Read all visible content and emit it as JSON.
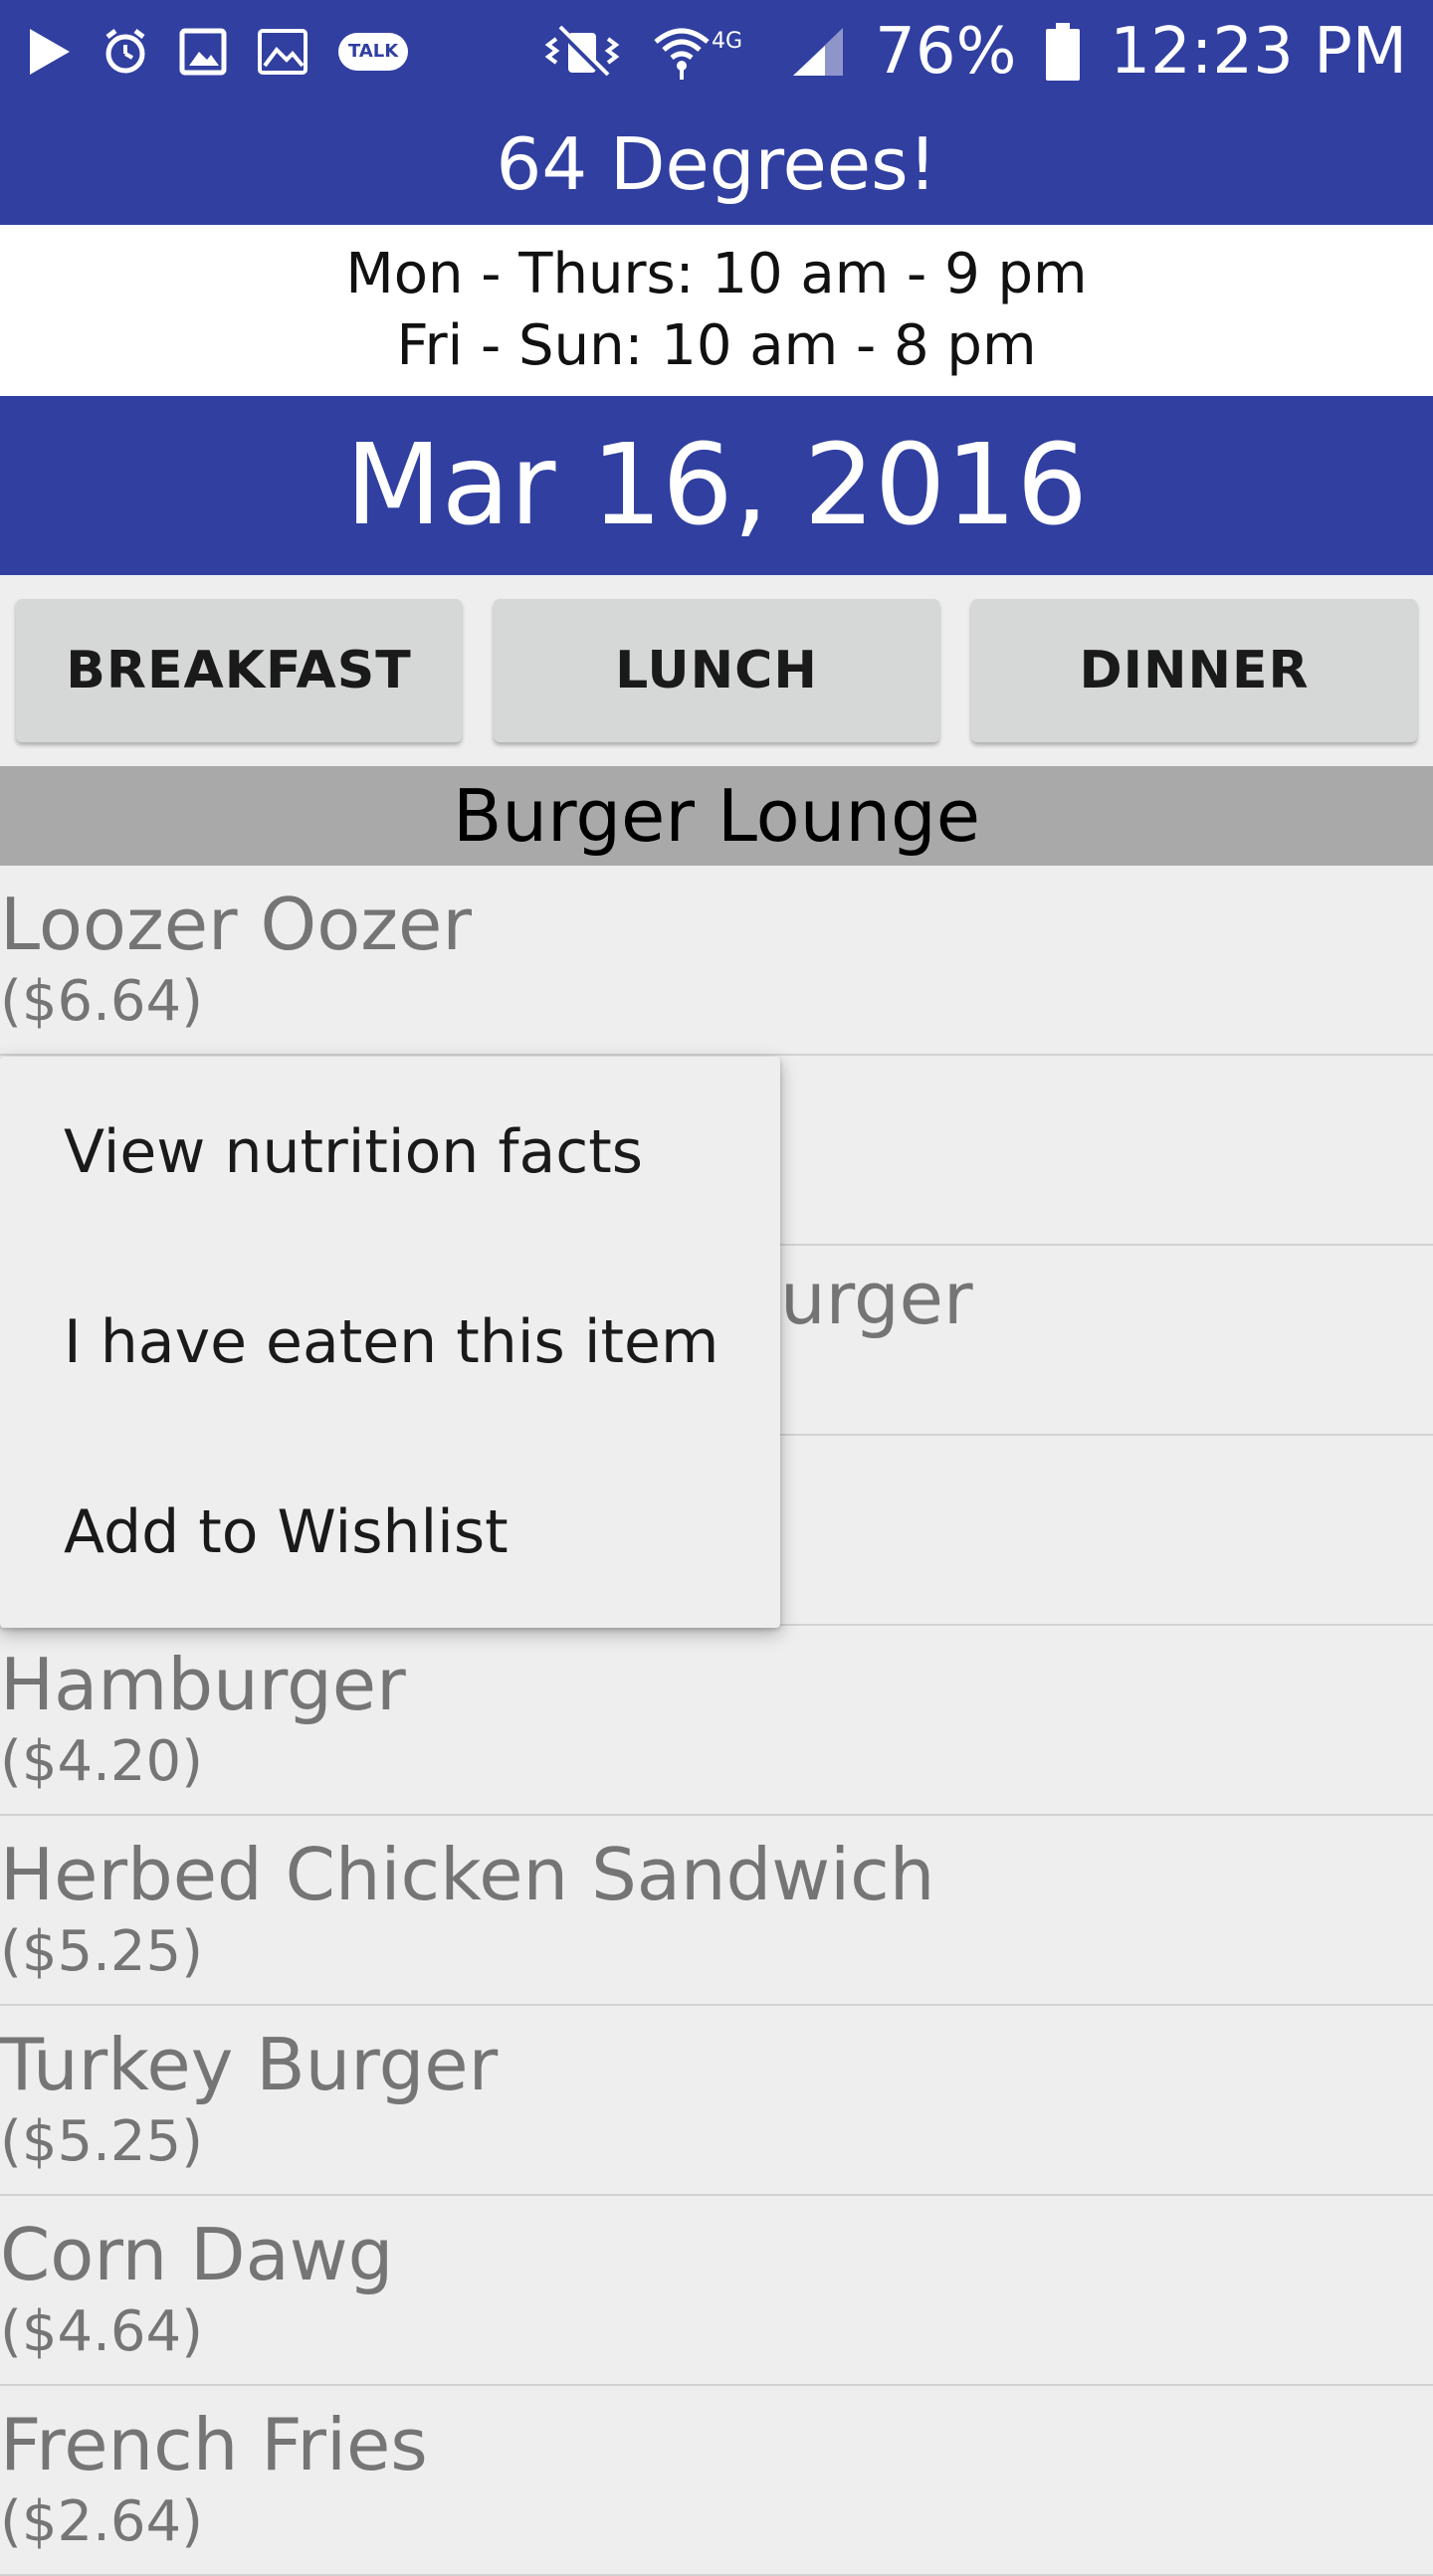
{
  "status_bar": {
    "talk_badge": "TALK",
    "network": "4G",
    "battery_percent": "76%",
    "time": "12:23 PM",
    "icons": [
      "play-icon",
      "alarm-icon",
      "image-icon",
      "gallery-icon",
      "talk-icon",
      "mute-icon",
      "wifi-icon",
      "signal-icon",
      "battery-icon"
    ]
  },
  "app": {
    "title": "64 Degrees!",
    "hours": [
      "Mon - Thurs: 10 am - 9 pm",
      "Fri - Sun: 10 am - 8 pm"
    ],
    "date": "Mar 16, 2016"
  },
  "meal_tabs": [
    "BREAKFAST",
    "LUNCH",
    "DINNER"
  ],
  "section": {
    "title": "Burger Lounge"
  },
  "menu_items": [
    {
      "name": "Loozer Oozer",
      "price": "($6.64)"
    },
    {
      "name": "",
      "price": ""
    },
    {
      "name": "urger",
      "price": ""
    },
    {
      "name": "",
      "price": ""
    },
    {
      "name": "Hamburger",
      "price": "($4.20)"
    },
    {
      "name": "Herbed Chicken Sandwich",
      "price": "($5.25)"
    },
    {
      "name": "Turkey Burger",
      "price": "($5.25)"
    },
    {
      "name": "Corn Dawg",
      "price": "($4.64)"
    },
    {
      "name": "French Fries",
      "price": "($2.64)"
    }
  ],
  "context_menu": {
    "items": [
      "View nutrition facts",
      "I have eaten this item",
      "Add to Wishlist"
    ]
  },
  "colors": {
    "primary": "#303fa0",
    "section_header": "#a9a9a9",
    "button": "#d6d7d7",
    "background": "#eeeeee"
  }
}
